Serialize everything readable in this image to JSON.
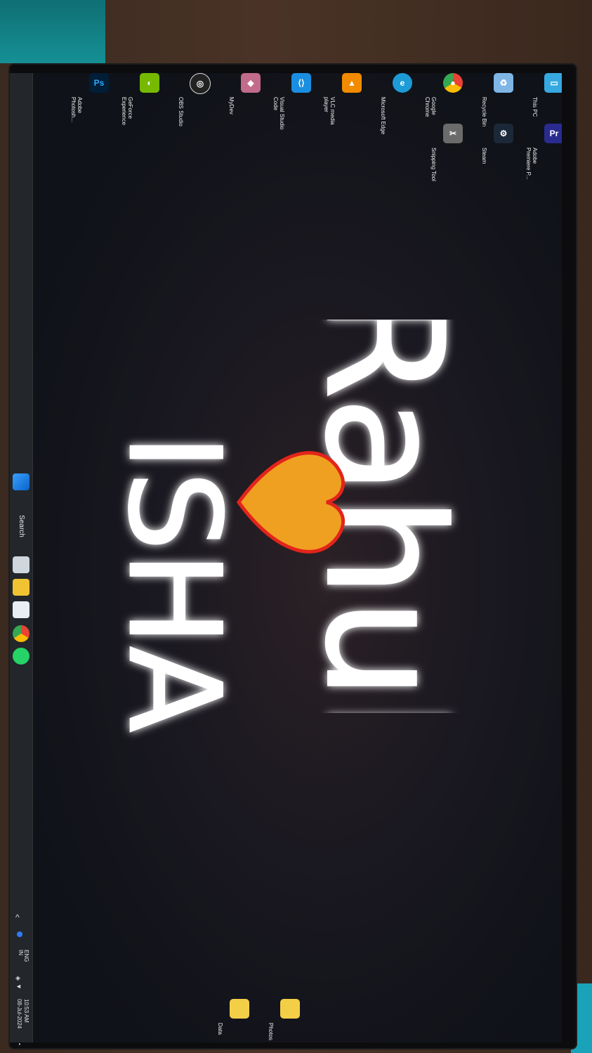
{
  "desktop": {
    "icons": [
      {
        "label": "This PC",
        "icon": "this-pc-icon",
        "color": "#36a9e1"
      },
      {
        "label": "Adobe Premiere P...",
        "icon": "premiere-icon",
        "color": "#2a2b8f"
      },
      {
        "label": "Recycle Bin",
        "icon": "recycle-bin-icon",
        "color": "#7fb6e6"
      },
      {
        "label": "Steam",
        "icon": "steam-icon",
        "color": "#1b2838"
      },
      {
        "label": "Google Chrome",
        "icon": "chrome-icon",
        "color": "#e94235"
      },
      {
        "label": "Snipping Tool",
        "icon": "snipping-tool-icon",
        "color": "#6b6b6b"
      },
      {
        "label": "Microsoft Edge",
        "icon": "edge-icon",
        "color": "#1d9bd7"
      },
      {
        "label": "VLC media player",
        "icon": "vlc-icon",
        "color": "#f28b00"
      },
      {
        "label": "Visual Studio Code",
        "icon": "vscode-icon",
        "color": "#1a8ee0"
      },
      {
        "label": "MyDev",
        "icon": "mydev-icon",
        "color": "#c26b8a"
      },
      {
        "label": "OBS Studio",
        "icon": "obs-icon",
        "color": "#222222"
      },
      {
        "label": "GeForce Experience",
        "icon": "geforce-icon",
        "color": "#76b900"
      },
      {
        "label": "Adobe Photosh...",
        "icon": "photoshop-icon",
        "color": "#001e36"
      },
      {
        "label": "Photos",
        "icon": "folder-icon",
        "color": "#f2cf47"
      },
      {
        "label": "Data",
        "icon": "folder-icon",
        "color": "#f2cf47"
      }
    ]
  },
  "wallpaper": {
    "text_top": "Rahul",
    "text_bottom": "ISHA",
    "heart_color": "#f0a020",
    "heart_outline": "#e3241b"
  },
  "taskbar": {
    "search_label": "Search",
    "tray": {
      "lang_line1": "ENG",
      "lang_line2": "IN",
      "time": "10:53 AM",
      "date": "08-Jul-2024"
    }
  }
}
